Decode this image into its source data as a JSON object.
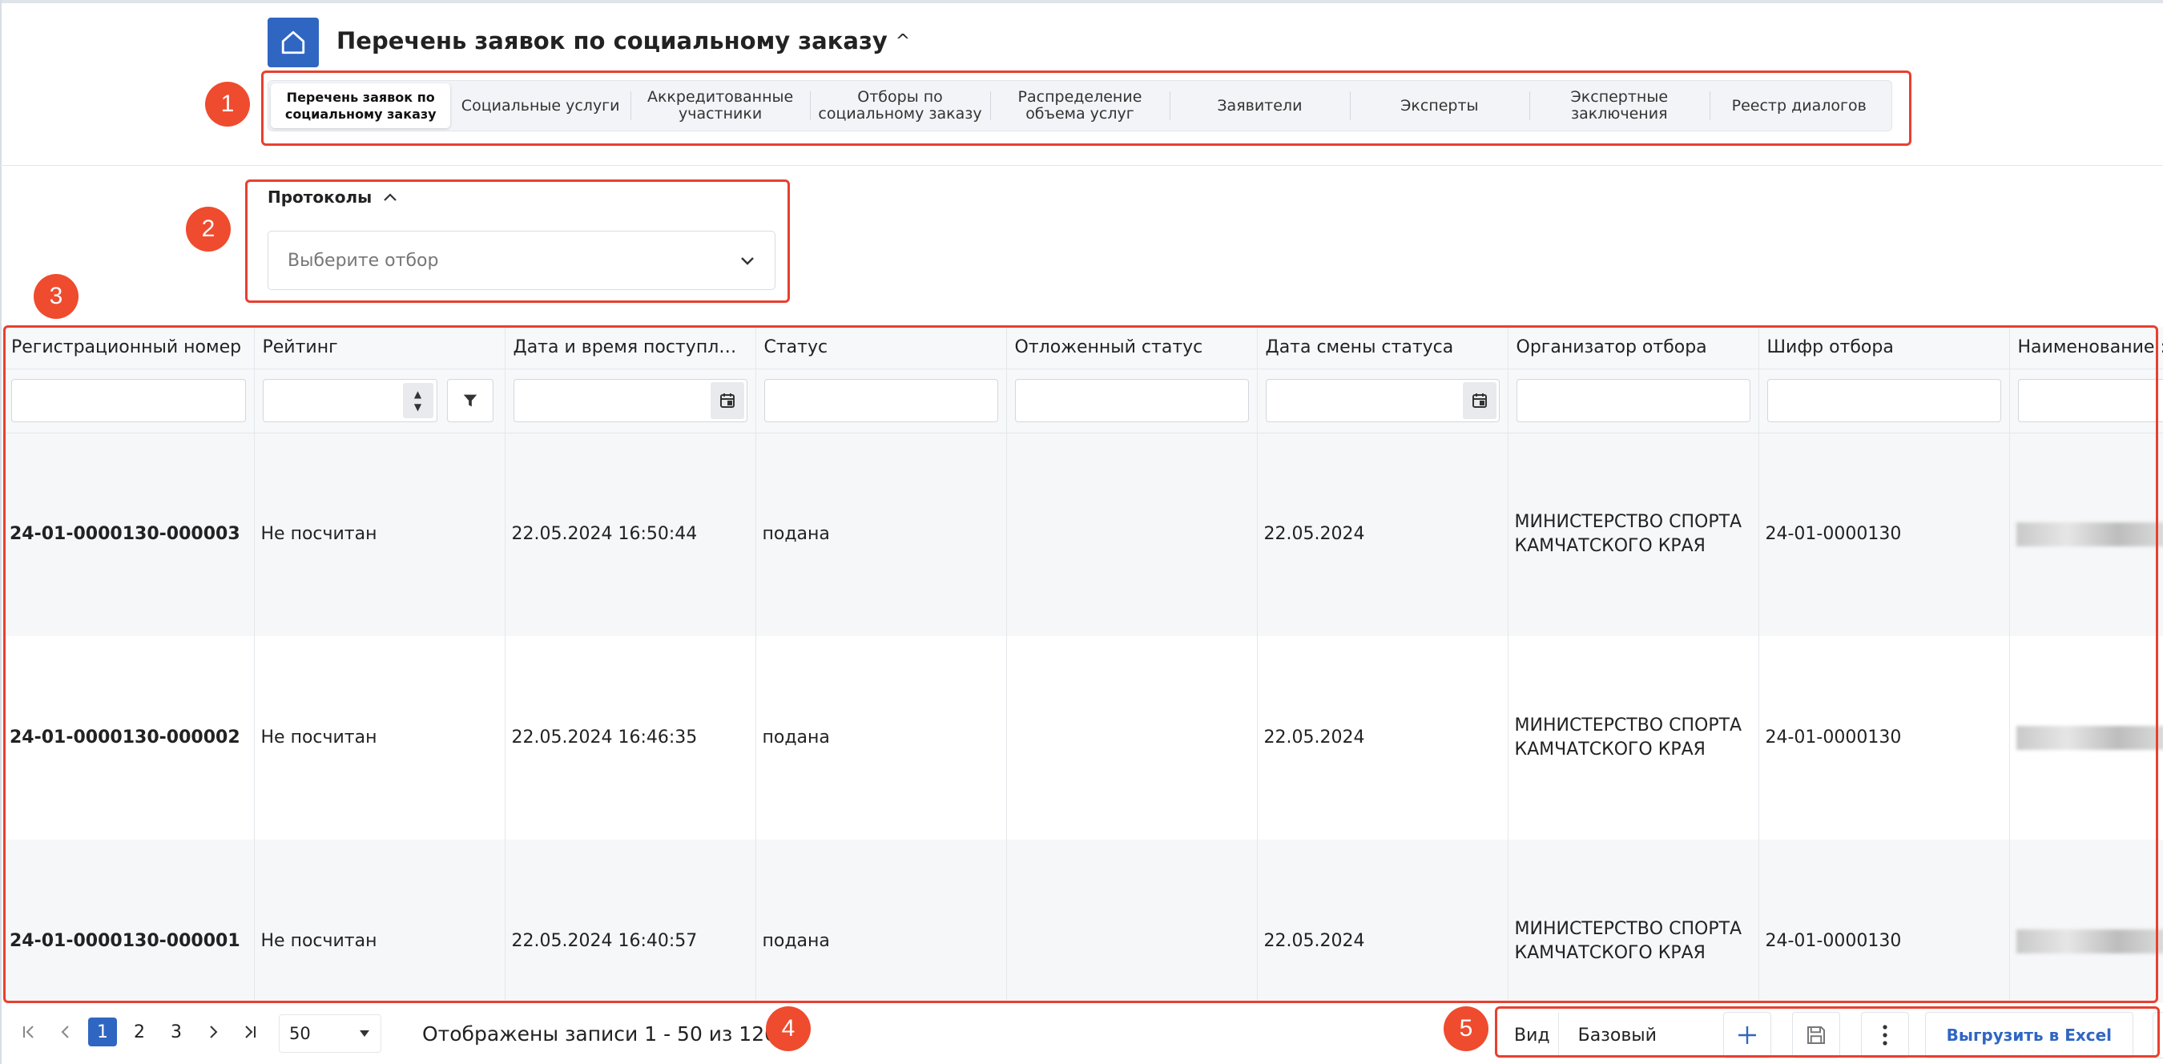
{
  "header": {
    "title": "Перечень заявок по социальному заказу",
    "title_chevron": "^"
  },
  "tabs": [
    {
      "label": "Перечень заявок по социальному заказу",
      "active": true
    },
    {
      "label": "Социальные услуги",
      "active": false
    },
    {
      "label": "Аккредитованные участники",
      "active": false
    },
    {
      "label": "Отборы по социальному заказу",
      "active": false
    },
    {
      "label": "Распределение объема услуг",
      "active": false
    },
    {
      "label": "Заявители",
      "active": false
    },
    {
      "label": "Эксперты",
      "active": false
    },
    {
      "label": "Экспертные заключения",
      "active": false
    },
    {
      "label": "Реестр диалогов",
      "active": false
    }
  ],
  "protocols": {
    "label": "Протоколы",
    "placeholder": "Выберите отбор"
  },
  "table": {
    "columns": [
      "Регистрационный номер",
      "Рейтинг",
      "Дата и время поступлен...",
      "Статус",
      "Отложенный статус",
      "Дата смены статуса",
      "Организатор отбора",
      "Шифр отбора",
      "Наименование :"
    ],
    "rows": [
      {
        "reg_number": "24-01-0000130-000003",
        "rating": "Не посчитан",
        "received": "22.05.2024 16:50:44",
        "status": "подана",
        "deferred_status": "",
        "status_change_date": "22.05.2024",
        "organizer": "МИНИСТЕРСТВО СПОРТА КАМЧАТСКОГО КРАЯ",
        "code": "24-01-0000130"
      },
      {
        "reg_number": "24-01-0000130-000002",
        "rating": "Не посчитан",
        "received": "22.05.2024 16:46:35",
        "status": "подана",
        "deferred_status": "",
        "status_change_date": "22.05.2024",
        "organizer": "МИНИСТЕРСТВО СПОРТА КАМЧАТСКОГО КРАЯ",
        "code": "24-01-0000130"
      },
      {
        "reg_number": "24-01-0000130-000001",
        "rating": "Не посчитан",
        "received": "22.05.2024 16:40:57",
        "status": "подана",
        "deferred_status": "",
        "status_change_date": "22.05.2024",
        "organizer": "МИНИСТЕРСТВО СПОРТА КАМЧАТСКОГО КРАЯ",
        "code": "24-01-0000130"
      }
    ]
  },
  "pagination": {
    "pages": [
      "1",
      "2",
      "3"
    ],
    "current_page": "1",
    "per_page": "50",
    "records_info": "Отображены записи 1 - 50 из 120"
  },
  "toolbar": {
    "view_label": "Вид",
    "view_value": "Базовый",
    "excel_label": "Выгрузить в Excel"
  },
  "annotations": [
    "1",
    "2",
    "3",
    "4",
    "5"
  ],
  "colors": {
    "accent": "#2f66c2",
    "annotation": "#e8402f",
    "link": "#1f3fd0"
  }
}
